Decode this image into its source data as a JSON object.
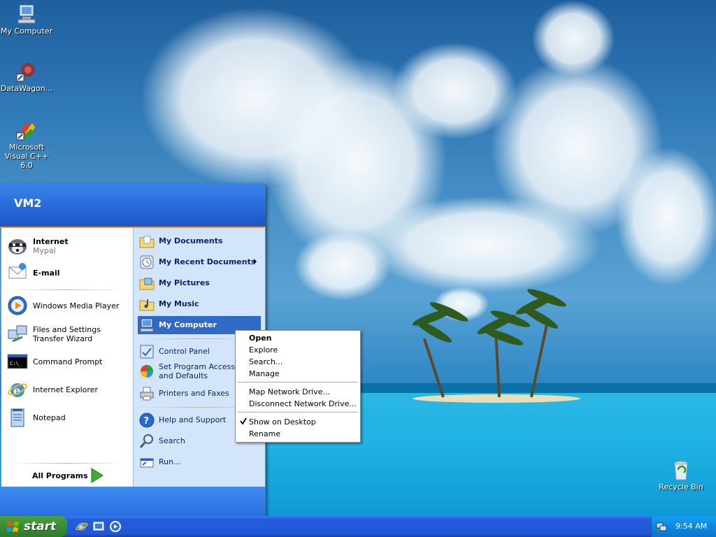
{
  "desktop": {
    "icons": [
      {
        "label": "My Computer",
        "icon": "my-computer-icon"
      },
      {
        "label": "DataWagon...",
        "icon": "datawagon-icon"
      },
      {
        "label": "Microsoft Visual C++ 6.0",
        "icon": "visual-cpp-icon"
      },
      {
        "label": "Recycle Bin",
        "icon": "recycle-bin-icon"
      }
    ]
  },
  "start_menu": {
    "user": "VM2",
    "left": {
      "pinned": [
        {
          "label": "Internet",
          "sublabel": "Mypal",
          "icon": "raccoon-browser-icon"
        },
        {
          "label": "E-mail",
          "icon": "email-icon"
        }
      ],
      "recent": [
        {
          "label": "Windows Media Player",
          "icon": "media-player-icon"
        },
        {
          "label": "Files and Settings Transfer Wizard",
          "icon": "transfer-wizard-icon"
        },
        {
          "label": "Command Prompt",
          "icon": "command-prompt-icon"
        },
        {
          "label": "Internet Explorer",
          "icon": "internet-explorer-icon"
        },
        {
          "label": "Notepad",
          "icon": "notepad-icon"
        }
      ],
      "all_programs": "All Programs"
    },
    "right": {
      "places": [
        {
          "label": "My Documents",
          "icon": "folder-documents-icon"
        },
        {
          "label": "My Recent Documents",
          "icon": "recent-documents-icon"
        },
        {
          "label": "My Pictures",
          "icon": "folder-pictures-icon"
        },
        {
          "label": "My Music",
          "icon": "folder-music-icon"
        },
        {
          "label": "My Computer",
          "icon": "my-computer-icon"
        }
      ],
      "settings": [
        {
          "label": "Control Panel",
          "icon": "control-panel-icon"
        },
        {
          "label": "Set Program Access and Defaults",
          "icon": "program-access-icon"
        },
        {
          "label": "Printers and Faxes",
          "icon": "printer-icon"
        }
      ],
      "help": [
        {
          "label": "Help and Support",
          "icon": "help-icon"
        },
        {
          "label": "Search",
          "icon": "search-icon"
        },
        {
          "label": "Run...",
          "icon": "run-icon"
        }
      ]
    }
  },
  "context_menu": {
    "items": [
      "Open",
      "Explore",
      "Search...",
      "Manage",
      "Map Network Drive...",
      "Disconnect Network Drive...",
      "Show on Desktop",
      "Rename"
    ],
    "checked": "Show on Desktop"
  },
  "taskbar": {
    "start_label": "start",
    "quick_launch": [
      "internet-explorer-icon",
      "show-desktop-icon",
      "media-player-icon"
    ],
    "clock": "9:54 AM"
  },
  "colors": {
    "taskbar_blue": "#245edb",
    "start_green": "#3b9235",
    "menu_selected": "#316ac5",
    "menu_right_bg": "#d3e5fa"
  }
}
